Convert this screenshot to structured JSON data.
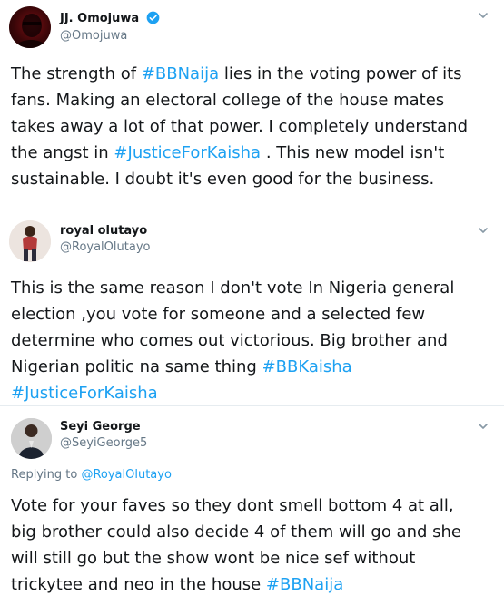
{
  "tweets": [
    {
      "name": "JJ. Omojuwa",
      "handle": "@Omojuwa",
      "verified": true,
      "text_a": "The strength of ",
      "tag_1": "#BBNaija",
      "text_b": " lies in the voting power of its\nfans. Making an electoral college of the house mates\ntakes away a lot of that power. I completely understand\nthe angst in ",
      "tag_2": "#JusticeForKaisha",
      "text_c": " . This new model isn't\nsustainable. I doubt it's even good for the business."
    },
    {
      "name": "royal olutayo",
      "handle": "@RoyalOlutayo",
      "text_a": "This is the same reason I don't vote In Nigeria general\nelection ,you vote for someone and a selected few\ndetermine who comes out victorious. Big brother and\nNigerian politic na same thing  ",
      "tag_1": "#BBKaisha",
      "text_b": "\n",
      "tag_2": "#JusticeForKaisha"
    },
    {
      "name": "Seyi George",
      "handle": "@SeyiGeorge5",
      "replying_label": "Replying to ",
      "replying_handle": "@RoyalOlutayo",
      "text_a": "Vote for your faves so they dont smell bottom 4 at all,\nbig brother could also decide 4 of them will go and she\nwill still go but the show wont be nice sef without\ntrickytee and neo in the house ",
      "tag_1": "#BBNaija"
    }
  ],
  "icons": {
    "verified": "verified-badge-icon",
    "menu": "chevron-down-icon"
  },
  "colors": {
    "link": "#1da1f2",
    "secondary_text": "#657786",
    "divider": "#e6ecf0"
  }
}
